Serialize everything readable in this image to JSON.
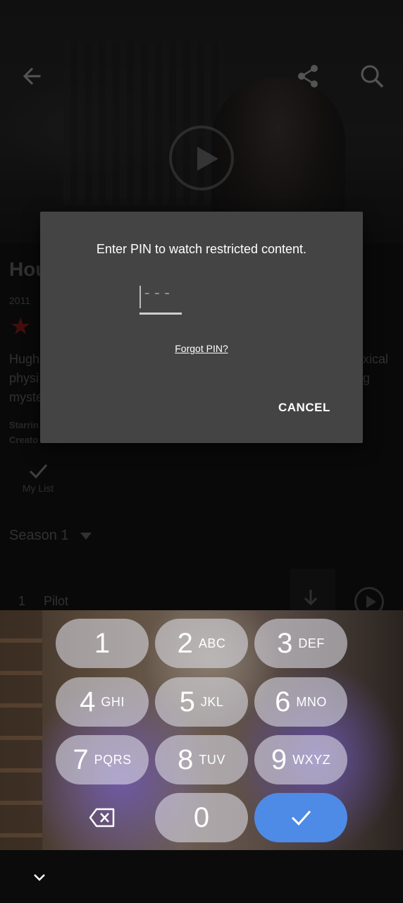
{
  "show": {
    "title": "Hou",
    "year": "2011",
    "description_fragments": [
      "Hugh",
      "physi",
      "myste",
      "xical",
      "g"
    ],
    "credits": [
      "Starrin",
      "Creato"
    ],
    "my_list_label": "My List",
    "season_label": "Season 1",
    "episode": {
      "number": "1",
      "title": "Pilot"
    }
  },
  "dialog": {
    "message": "Enter PIN to watch restricted content.",
    "pin_placeholder": "---",
    "forgot_label": "Forgot PIN?",
    "cancel_label": "CANCEL"
  },
  "keyboard": {
    "keys": [
      {
        "digit": "1",
        "letters": ""
      },
      {
        "digit": "2",
        "letters": "ABC"
      },
      {
        "digit": "3",
        "letters": "DEF"
      },
      {
        "digit": "4",
        "letters": "GHI"
      },
      {
        "digit": "5",
        "letters": "JKL"
      },
      {
        "digit": "6",
        "letters": "MNO"
      },
      {
        "digit": "7",
        "letters": "PQRS"
      },
      {
        "digit": "8",
        "letters": "TUV"
      },
      {
        "digit": "9",
        "letters": "WXYZ"
      },
      {
        "digit": "0",
        "letters": ""
      }
    ],
    "backspace_icon": "backspace-icon",
    "enter_icon": "check-icon"
  },
  "colors": {
    "enter_key": "#4d8be6",
    "dialog_bg": "#444444",
    "star": "#7a1a1a"
  }
}
